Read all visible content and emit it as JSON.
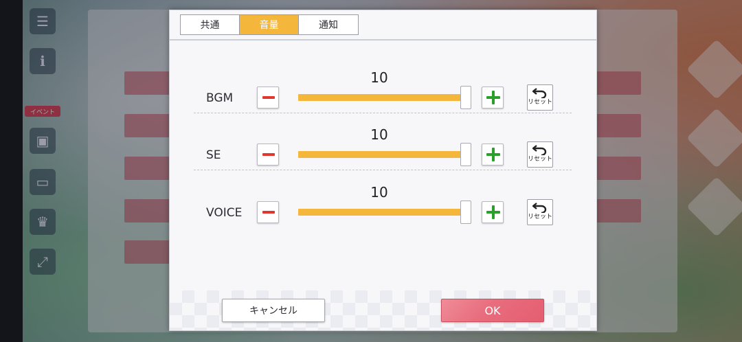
{
  "tabs": [
    {
      "label": "共通",
      "active": false
    },
    {
      "label": "音量",
      "active": true
    },
    {
      "label": "通知",
      "active": false
    }
  ],
  "volume_rows": [
    {
      "label": "BGM",
      "value": "10",
      "level": 1.0,
      "reset_label": "リセット"
    },
    {
      "label": "SE",
      "value": "10",
      "level": 1.0,
      "reset_label": "リセット"
    },
    {
      "label": "VOICE",
      "value": "10",
      "level": 1.0,
      "reset_label": "リセット"
    }
  ],
  "footer": {
    "cancel_label": "キャンセル",
    "ok_label": "OK"
  },
  "background": {
    "event_badge": "イベント"
  },
  "colors": {
    "accent": "#f4b63b",
    "minus": "#e0372f",
    "plus": "#2aa02a",
    "ok": "#e86d7d"
  }
}
